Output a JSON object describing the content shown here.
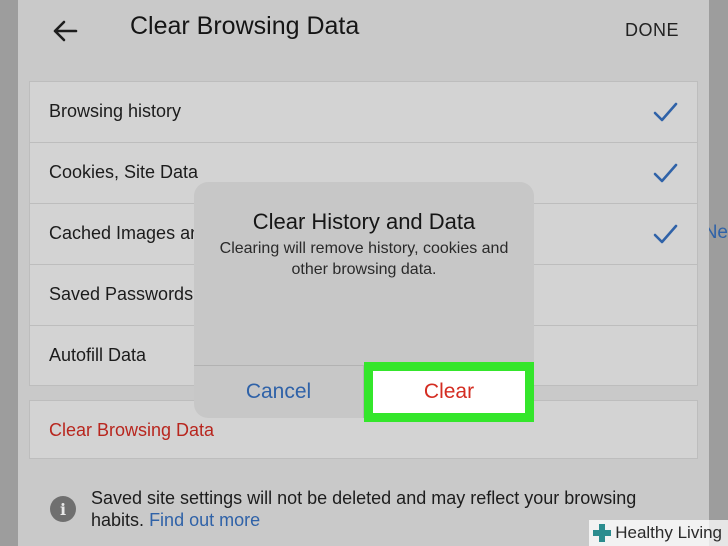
{
  "header": {
    "back_icon": "arrow-left-icon",
    "title": "Clear Browsing Data",
    "done_label": "DONE"
  },
  "options": [
    {
      "label": "Browsing history",
      "checked": true
    },
    {
      "label": "Cookies, Site Data",
      "checked": true
    },
    {
      "label": "Cached Images and Files",
      "checked": true
    },
    {
      "label": "Saved Passwords",
      "checked": false
    },
    {
      "label": "Autofill Data",
      "checked": false
    }
  ],
  "clear_row": {
    "label": "Clear Browsing Data"
  },
  "info": {
    "icon": "info-icon",
    "text": "Saved site settings will not be deleted and may reflect your browsing habits.",
    "link": "Find out more"
  },
  "edge_link": "Ne",
  "dialog": {
    "title": "Clear History and Data",
    "message": "Clearing will remove history, cookies and other browsing data.",
    "cancel_label": "Cancel",
    "clear_label": "Clear"
  },
  "watermark": "Healthy Living",
  "colors": {
    "accent_blue": "#2f62a8",
    "destructive_red": "#d42d22",
    "highlight_green": "#34e62b"
  }
}
